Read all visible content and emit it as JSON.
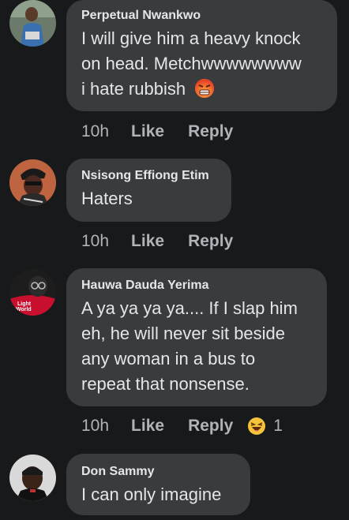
{
  "comments": [
    {
      "author": "Perpetual Nwankwo",
      "lines": [
        "I will give him a heavy knock",
        "on head. Metchwwwwwwww",
        "i hate rubbish"
      ],
      "time": "10h",
      "like": "Like",
      "reply": "Reply",
      "inline_emoji": "angry-face-icon"
    },
    {
      "author": "Nsisong Effiong Etim",
      "lines": [
        "Haters"
      ],
      "time": "10h",
      "like": "Like",
      "reply": "Reply"
    },
    {
      "author": "Hauwa Dauda Yerima",
      "lines": [
        "A ya ya ya ya.... If I slap him",
        "eh, he will never sit beside",
        "any woman in a bus to",
        "repeat that nonsense."
      ],
      "time": "10h",
      "like": "Like",
      "reply": "Reply",
      "reaction_icon": "haha-reaction-icon",
      "reaction_count": "1"
    },
    {
      "author": "Don Sammy",
      "lines": [
        "I can only imagine"
      ]
    }
  ],
  "colors": {
    "background": "#18191a",
    "bubble": "#3a3b3c",
    "text": "#e4e6eb",
    "meta": "#b0b3b8"
  }
}
